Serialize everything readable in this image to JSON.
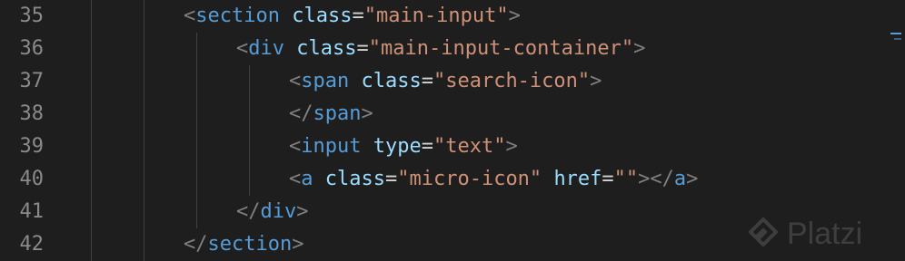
{
  "editor": {
    "line_numbers": [
      "35",
      "36",
      "37",
      "38",
      "39",
      "40",
      "41",
      "42"
    ],
    "lines": [
      {
        "indent": 2,
        "tokens": [
          {
            "t": "<",
            "c": "bracket"
          },
          {
            "t": "section",
            "c": "tag"
          },
          {
            "t": " ",
            "c": "eq"
          },
          {
            "t": "class",
            "c": "attr"
          },
          {
            "t": "=",
            "c": "eq"
          },
          {
            "t": "\"main-input\"",
            "c": "str"
          },
          {
            "t": ">",
            "c": "bracket"
          }
        ]
      },
      {
        "indent": 3,
        "tokens": [
          {
            "t": "<",
            "c": "bracket"
          },
          {
            "t": "div",
            "c": "tag"
          },
          {
            "t": " ",
            "c": "eq"
          },
          {
            "t": "class",
            "c": "attr"
          },
          {
            "t": "=",
            "c": "eq"
          },
          {
            "t": "\"main-input-container\"",
            "c": "str"
          },
          {
            "t": ">",
            "c": "bracket"
          }
        ]
      },
      {
        "indent": 4,
        "tokens": [
          {
            "t": "<",
            "c": "bracket"
          },
          {
            "t": "span",
            "c": "tag"
          },
          {
            "t": " ",
            "c": "eq"
          },
          {
            "t": "class",
            "c": "attr"
          },
          {
            "t": "=",
            "c": "eq"
          },
          {
            "t": "\"search-icon\"",
            "c": "str"
          },
          {
            "t": ">",
            "c": "bracket"
          }
        ]
      },
      {
        "indent": 4,
        "tokens": [
          {
            "t": "</",
            "c": "bracket"
          },
          {
            "t": "span",
            "c": "tag"
          },
          {
            "t": ">",
            "c": "bracket"
          }
        ]
      },
      {
        "indent": 4,
        "tokens": [
          {
            "t": "<",
            "c": "bracket"
          },
          {
            "t": "input",
            "c": "tag"
          },
          {
            "t": " ",
            "c": "eq"
          },
          {
            "t": "type",
            "c": "attr"
          },
          {
            "t": "=",
            "c": "eq"
          },
          {
            "t": "\"text\"",
            "c": "str"
          },
          {
            "t": ">",
            "c": "bracket"
          }
        ]
      },
      {
        "indent": 4,
        "tokens": [
          {
            "t": "<",
            "c": "bracket"
          },
          {
            "t": "a",
            "c": "tag"
          },
          {
            "t": " ",
            "c": "eq"
          },
          {
            "t": "class",
            "c": "attr"
          },
          {
            "t": "=",
            "c": "eq"
          },
          {
            "t": "\"micro-icon\"",
            "c": "str"
          },
          {
            "t": " ",
            "c": "eq"
          },
          {
            "t": "href",
            "c": "attr"
          },
          {
            "t": "=",
            "c": "eq"
          },
          {
            "t": "\"\"",
            "c": "str"
          },
          {
            "t": "></",
            "c": "bracket"
          },
          {
            "t": "a",
            "c": "tag"
          },
          {
            "t": ">",
            "c": "bracket"
          }
        ]
      },
      {
        "indent": 3,
        "tokens": [
          {
            "t": "</",
            "c": "bracket"
          },
          {
            "t": "div",
            "c": "tag"
          },
          {
            "t": ">",
            "c": "bracket"
          }
        ]
      },
      {
        "indent": 2,
        "tokens": [
          {
            "t": "</",
            "c": "bracket"
          },
          {
            "t": "section",
            "c": "tag"
          },
          {
            "t": ">",
            "c": "bracket"
          }
        ]
      }
    ]
  },
  "colors": {
    "background": "#1e1e1e",
    "line_number": "#8a8a8a",
    "bracket": "#808080",
    "tag": "#569cd6",
    "attribute": "#9cdcfe",
    "string": "#ce9178",
    "equals": "#d4d4d4"
  },
  "watermark": {
    "text": "Platzi",
    "icon": "platzi-logo-icon"
  }
}
